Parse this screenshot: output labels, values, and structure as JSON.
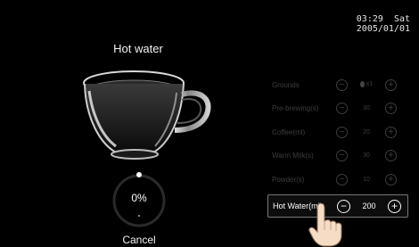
{
  "status": {
    "time": "03:29",
    "day": "Sat",
    "date": "2005/01/01"
  },
  "screen": {
    "title": "Hot water",
    "cancel_label": "Cancel"
  },
  "progress": {
    "percent_label": "0%",
    "value": 0
  },
  "settings": [
    {
      "id": "grounds",
      "label": "Grounds",
      "value": "x1",
      "active": false
    },
    {
      "id": "pre-brewing",
      "label": "Pre-brewing(s)",
      "value": "30",
      "active": false
    },
    {
      "id": "coffee",
      "label": "Coffee(ml)",
      "value": "20",
      "active": false
    },
    {
      "id": "warm-milk",
      "label": "Warm Milk(s)",
      "value": "30",
      "active": false
    },
    {
      "id": "powder",
      "label": "Powder(s)",
      "value": "10",
      "active": false
    },
    {
      "id": "hot-water",
      "label": "Hot Water(ml)",
      "value": "200",
      "active": true
    }
  ],
  "icons": {
    "minus": "minus-circle-icon",
    "plus": "plus-circle-icon",
    "cup": "glass-cup-image",
    "hand": "pointing-hand-icon"
  },
  "colors": {
    "background": "#000000",
    "inactive_text": "#3d3d3d",
    "active_text": "#ffffff",
    "active_border": "#777777"
  }
}
